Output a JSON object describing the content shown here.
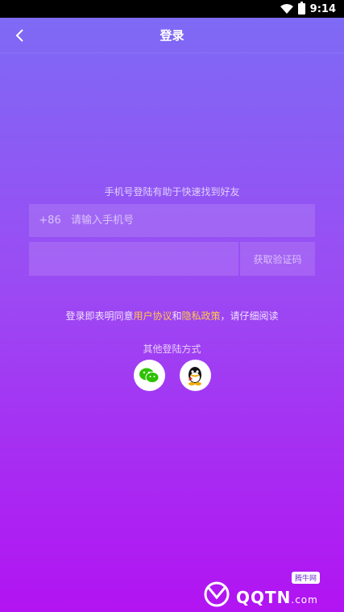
{
  "status": {
    "time": "9:14"
  },
  "nav": {
    "title": "登录"
  },
  "login": {
    "hint": "手机号登陆有助于快速找到好友",
    "country_code": "+86",
    "phone_placeholder": "请输入手机号",
    "code_placeholder": "",
    "get_code_label": "获取验证码"
  },
  "agreement": {
    "prefix": "登录即表明同意",
    "user_agreement": "用户协议",
    "and": "和",
    "privacy_policy": "隐私政策",
    "suffix": "，请仔细阅读"
  },
  "other_login": {
    "title": "其他登陆方式",
    "options": [
      "wechat-icon",
      "qq-icon"
    ]
  },
  "watermark": {
    "badge": "腾牛网",
    "text": "QQTN",
    "suffix": ".com"
  },
  "colors": {
    "link": "#ffc94a",
    "gradient_top": "#7c6cf5",
    "gradient_bottom": "#b213f2"
  }
}
